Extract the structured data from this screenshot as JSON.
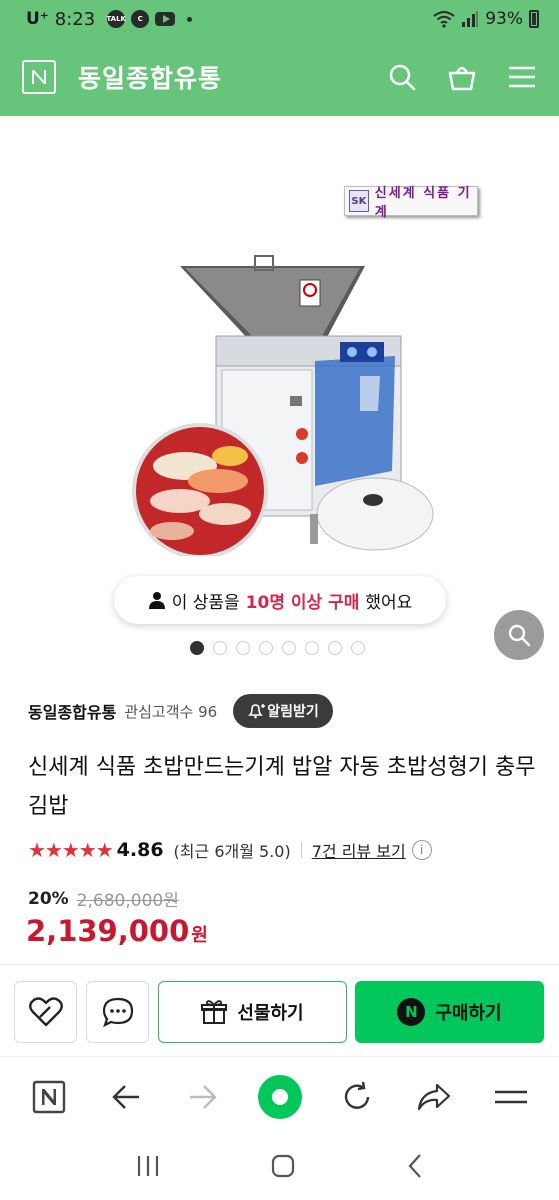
{
  "status_bar": {
    "carrier": "U⁺",
    "time": "8:23",
    "badges": [
      "TALK",
      "C"
    ],
    "battery": "93%"
  },
  "header": {
    "logo_letter": "N",
    "store_title": "동일종합유통",
    "icons": [
      "search-icon",
      "shopping-bag-icon",
      "menu-icon"
    ]
  },
  "hero": {
    "brand_tag_logo": "SK",
    "brand_tag_text": "신세계 식품 기계",
    "buyer_notice": {
      "prefix": "이 상품을 ",
      "highlight": "10명 이상 구매",
      "suffix": " 했어요"
    },
    "carousel": {
      "total": 8,
      "active": 0
    }
  },
  "store": {
    "name": "동일종합유통",
    "followers": "관심고객수 96",
    "alarm_label": "알림받기"
  },
  "product": {
    "title": "신세계 식품 초밥만드는기계 밥알 자동 초밥성형기 충무김밥",
    "rating": {
      "stars": "★★★★★",
      "score": "4.86",
      "recent": "(최근 6개월 5.0)",
      "reviews": "7건 리뷰 보기",
      "info": "i"
    },
    "discount": "20%",
    "original_price": "2,680,000원",
    "price": "2,139,000",
    "currency": "원"
  },
  "actions": {
    "gift_label": "선물하기",
    "buy_label": "구매하기",
    "npay_letter": "N"
  },
  "browser_bar": {
    "logo_letter": "N",
    "icons": [
      "naver-home-icon",
      "back-arrow-icon",
      "forward-arrow-icon",
      "green-dot-icon",
      "refresh-icon",
      "share-icon",
      "menu-icon"
    ]
  },
  "colors": {
    "header_green": "#66c57a",
    "buy_green": "#03c75a",
    "price_red": "#c8182f",
    "star_red": "#e0323c"
  }
}
